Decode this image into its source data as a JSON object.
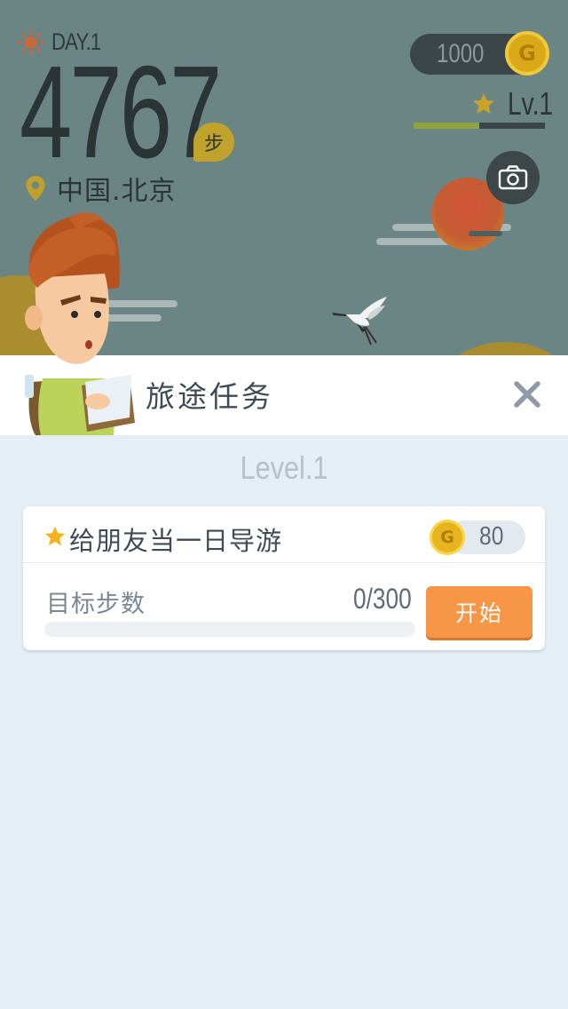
{
  "header": {
    "day_label": "DAY.1",
    "step_count": "4767",
    "step_unit": "步",
    "location": "中国.北京",
    "coins": "1000",
    "coin_symbol": "G",
    "level_label": "Lv.1",
    "level_progress_fraction": 0.5
  },
  "icons": {
    "day": "sun-icon",
    "location": "map-pin-icon",
    "coin": "gold-coin-icon",
    "level": "star-icon",
    "camera": "camera-icon",
    "close": "close-icon"
  },
  "panel": {
    "title": "旅途任务",
    "level_title": "Level.1"
  },
  "tasks": [
    {
      "name": "给朋友当一日导游",
      "reward_symbol": "G",
      "reward": "80",
      "goal_label": "目标步数",
      "goal_progress": "0/300",
      "progress_fraction": 0,
      "action_label": "开始"
    }
  ],
  "colors": {
    "sky": "#6b8585",
    "hill": "#a98d2f",
    "accent_orange": "#f79646",
    "coin_gold": "#e7b41f",
    "level_bar": "#8fa23e",
    "panel_bg": "#e5edf5"
  }
}
